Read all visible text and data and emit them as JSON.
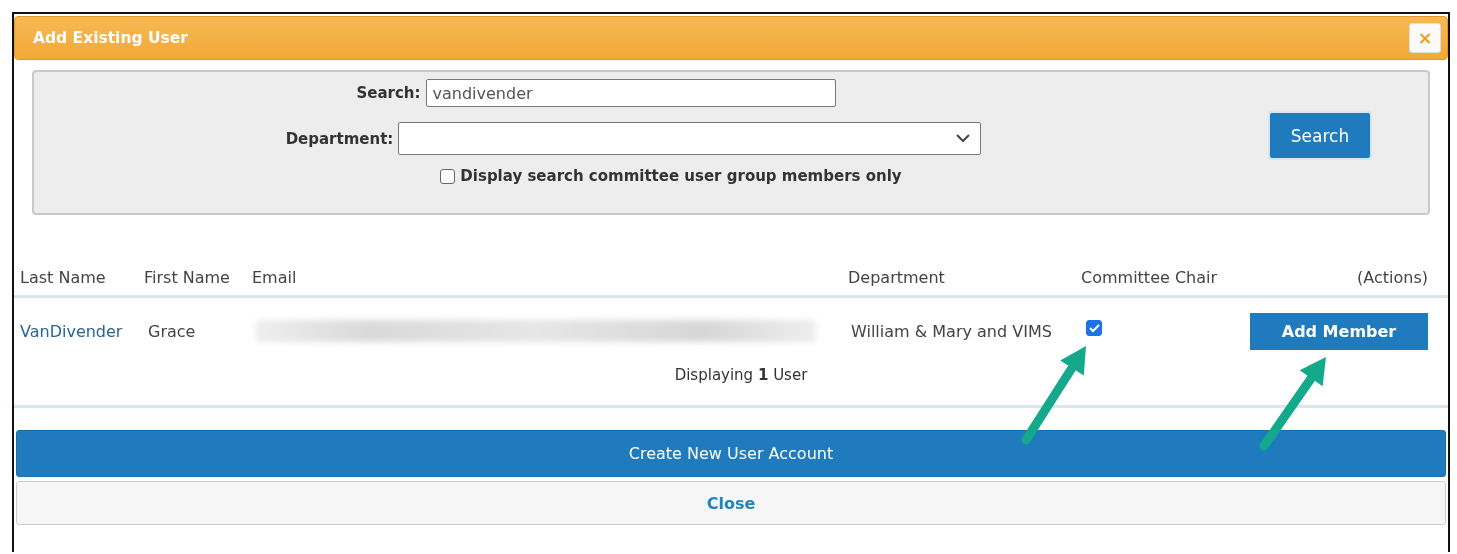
{
  "dialog": {
    "title": "Add Existing User",
    "close_icon": "×"
  },
  "search_panel": {
    "search_label": "Search:",
    "search_value": "vandivender",
    "department_label": "Department:",
    "members_only_label": "Display search committee user group members only",
    "members_only_checked": false,
    "search_button": "Search"
  },
  "table": {
    "columns": [
      "Last Name",
      "First Name",
      "Email",
      "Department",
      "Committee Chair",
      "(Actions)"
    ],
    "rows": [
      {
        "last_name": "VanDivender",
        "first_name": "Grace",
        "email_blurred": true,
        "department": "William & Mary and VIMS",
        "committee_chair": true,
        "action": "Add Member"
      }
    ],
    "summary": "Displaying **1** User"
  },
  "annotations": [
    {
      "kind": "arrow"
    },
    {
      "kind": "arrow"
    }
  ],
  "buttons": [
    {
      "label": "Create New User Account",
      "kind": "primary"
    },
    {
      "label": "Close",
      "kind": "secondary"
    }
  ]
}
